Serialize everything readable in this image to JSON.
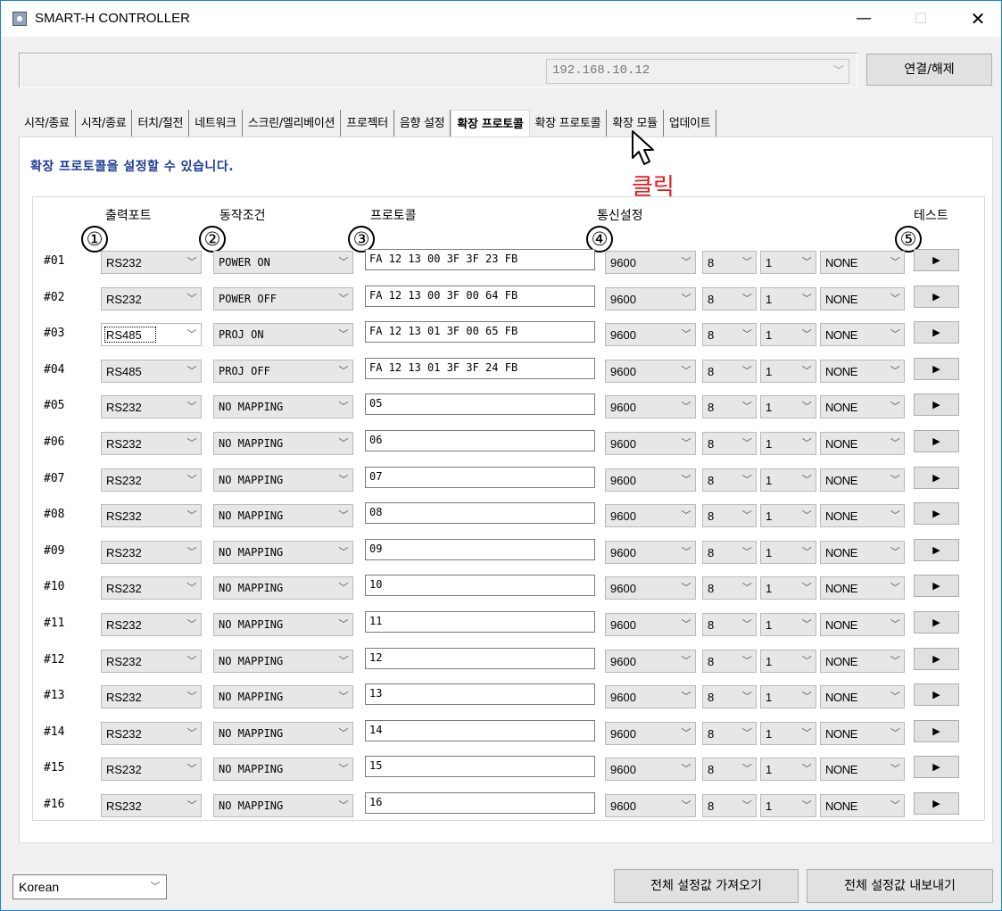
{
  "window": {
    "title": "SMART-H CONTROLLER",
    "min": "—",
    "max": "☐",
    "close": "✕"
  },
  "connection": {
    "ip": "192.168.10.12",
    "button": "연결/해제",
    "arrow": "﹀"
  },
  "tabs": [
    {
      "label": "시작/종료"
    },
    {
      "label": "시작/종료"
    },
    {
      "label": "터치/절전"
    },
    {
      "label": "네트워크"
    },
    {
      "label": "스크린/엘리베이션"
    },
    {
      "label": "프로젝터"
    },
    {
      "label": "음향 설정"
    },
    {
      "label": "확장 프로토콜",
      "active": true
    },
    {
      "label": "확장 프로토콜"
    },
    {
      "label": "확장 모듈"
    },
    {
      "label": "업데이트"
    }
  ],
  "panel": {
    "description": "확장 프로토콜을 설정할 수 있습니다.",
    "headers": {
      "port": "출력포트",
      "condition": "동작조건",
      "protocol": "프로토콜",
      "comm": "통신설정",
      "test": "테스트"
    },
    "markers": [
      "①",
      "②",
      "③",
      "④",
      "⑤"
    ]
  },
  "annotation": {
    "click": "클릭",
    "cursor_icon": "mouse-pointer-icon"
  },
  "rows": [
    {
      "num": "#01",
      "port": "RS232",
      "condition": "POWER ON",
      "protocol": "FA 12 13 00 3F 3F 23 FB",
      "baud": "9600",
      "data_bits": "8",
      "stop_bits": "1",
      "parity": "NONE"
    },
    {
      "num": "#02",
      "port": "RS232",
      "condition": "POWER OFF",
      "protocol": "FA 12 13 00 3F 00 64 FB",
      "baud": "9600",
      "data_bits": "8",
      "stop_bits": "1",
      "parity": "NONE"
    },
    {
      "num": "#03",
      "port": "RS485",
      "condition": "PROJ ON",
      "protocol": "FA 12 13 01 3F 00 65 FB",
      "baud": "9600",
      "data_bits": "8",
      "stop_bits": "1",
      "parity": "NONE",
      "focused": true
    },
    {
      "num": "#04",
      "port": "RS485",
      "condition": "PROJ OFF",
      "protocol": "FA 12 13 01 3F 3F 24 FB",
      "baud": "9600",
      "data_bits": "8",
      "stop_bits": "1",
      "parity": "NONE"
    },
    {
      "num": "#05",
      "port": "RS232",
      "condition": "NO MAPPING",
      "protocol": "05",
      "baud": "9600",
      "data_bits": "8",
      "stop_bits": "1",
      "parity": "NONE"
    },
    {
      "num": "#06",
      "port": "RS232",
      "condition": "NO MAPPING",
      "protocol": "06",
      "baud": "9600",
      "data_bits": "8",
      "stop_bits": "1",
      "parity": "NONE"
    },
    {
      "num": "#07",
      "port": "RS232",
      "condition": "NO MAPPING",
      "protocol": "07",
      "baud": "9600",
      "data_bits": "8",
      "stop_bits": "1",
      "parity": "NONE"
    },
    {
      "num": "#08",
      "port": "RS232",
      "condition": "NO MAPPING",
      "protocol": "08",
      "baud": "9600",
      "data_bits": "8",
      "stop_bits": "1",
      "parity": "NONE"
    },
    {
      "num": "#09",
      "port": "RS232",
      "condition": "NO MAPPING",
      "protocol": "09",
      "baud": "9600",
      "data_bits": "8",
      "stop_bits": "1",
      "parity": "NONE"
    },
    {
      "num": "#10",
      "port": "RS232",
      "condition": "NO MAPPING",
      "protocol": "10",
      "baud": "9600",
      "data_bits": "8",
      "stop_bits": "1",
      "parity": "NONE"
    },
    {
      "num": "#11",
      "port": "RS232",
      "condition": "NO MAPPING",
      "protocol": "11",
      "baud": "9600",
      "data_bits": "8",
      "stop_bits": "1",
      "parity": "NONE"
    },
    {
      "num": "#12",
      "port": "RS232",
      "condition": "NO MAPPING",
      "protocol": "12",
      "baud": "9600",
      "data_bits": "8",
      "stop_bits": "1",
      "parity": "NONE"
    },
    {
      "num": "#13",
      "port": "RS232",
      "condition": "NO MAPPING",
      "protocol": "13",
      "baud": "9600",
      "data_bits": "8",
      "stop_bits": "1",
      "parity": "NONE"
    },
    {
      "num": "#14",
      "port": "RS232",
      "condition": "NO MAPPING",
      "protocol": "14",
      "baud": "9600",
      "data_bits": "8",
      "stop_bits": "1",
      "parity": "NONE"
    },
    {
      "num": "#15",
      "port": "RS232",
      "condition": "NO MAPPING",
      "protocol": "15",
      "baud": "9600",
      "data_bits": "8",
      "stop_bits": "1",
      "parity": "NONE"
    },
    {
      "num": "#16",
      "port": "RS232",
      "condition": "NO MAPPING",
      "protocol": "16",
      "baud": "9600",
      "data_bits": "8",
      "stop_bits": "1",
      "parity": "NONE"
    }
  ],
  "footer": {
    "language": "Korean",
    "import": "전체 설정값 가져오기",
    "export": "전체 설정값 내보내기"
  },
  "icons": {
    "dropdown": "chevron-down-icon",
    "play": "play-icon",
    "app": "app-icon"
  },
  "colors": {
    "description": "#1d3c95",
    "click_label": "#e31b23",
    "window_border": "#1883d7"
  }
}
